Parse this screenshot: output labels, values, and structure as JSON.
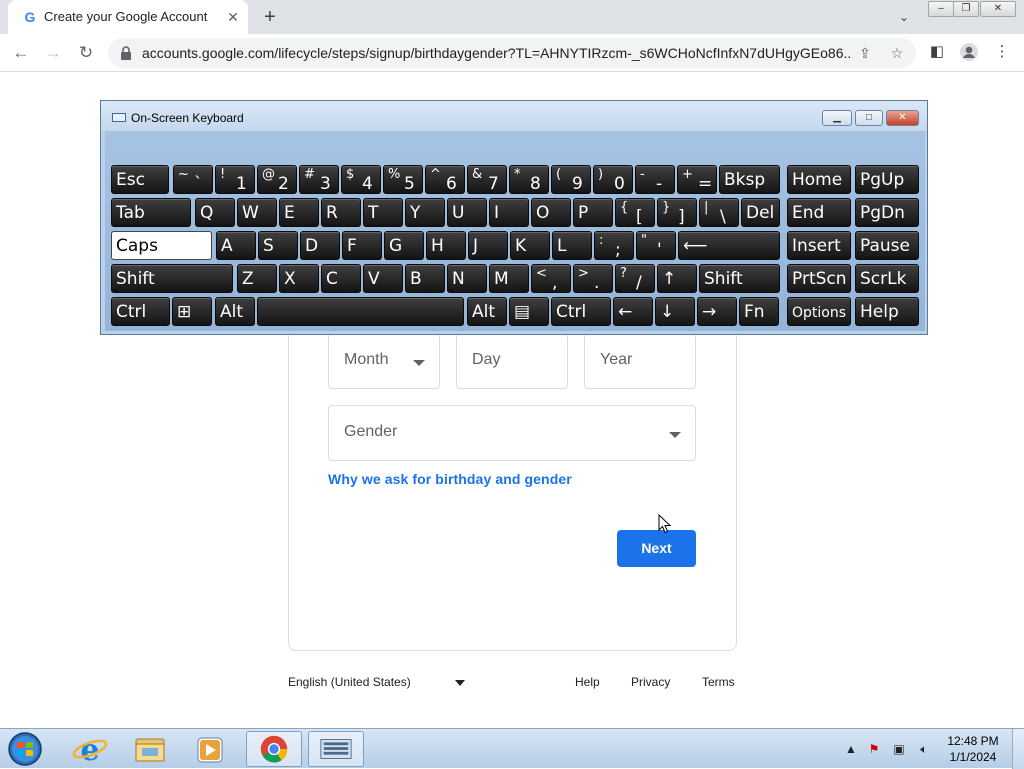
{
  "browser": {
    "tab_title": "Create your Google Account",
    "tab_favicon": "G",
    "url": "accounts.google.com/lifecycle/steps/signup/birthdaygender?TL=AHNYTIRzcm-_s6WCHoNcfInfxN7dUHgyGEo86..."
  },
  "form": {
    "month_placeholder": "Month",
    "day_placeholder": "Day",
    "year_placeholder": "Year",
    "gender_placeholder": "Gender",
    "why_link": "Why we ask for birthday and gender",
    "next_label": "Next"
  },
  "footer": {
    "language": "English (United States)",
    "help": "Help",
    "privacy": "Privacy",
    "terms": "Terms"
  },
  "osk": {
    "title": "On-Screen Keyboard",
    "rows": [
      [
        {
          "label": "Esc"
        },
        {
          "shift": "~",
          "main": "`"
        },
        {
          "shift": "!",
          "main": "1"
        },
        {
          "shift": "@",
          "main": "2"
        },
        {
          "shift": "#",
          "main": "3"
        },
        {
          "shift": "$",
          "main": "4"
        },
        {
          "shift": "%",
          "main": "5"
        },
        {
          "shift": "^",
          "main": "6"
        },
        {
          "shift": "&",
          "main": "7"
        },
        {
          "shift": "*",
          "main": "8"
        },
        {
          "shift": "(",
          "main": "9"
        },
        {
          "shift": ")",
          "main": "0"
        },
        {
          "shift": "-",
          "main": "-"
        },
        {
          "shift": "+",
          "main": "="
        },
        {
          "label": "Bksp"
        },
        {
          "label": "Home"
        },
        {
          "label": "PgUp"
        }
      ],
      [
        {
          "label": "Tab"
        },
        {
          "label": "Q"
        },
        {
          "label": "W"
        },
        {
          "label": "E"
        },
        {
          "label": "R"
        },
        {
          "label": "T"
        },
        {
          "label": "Y"
        },
        {
          "label": "U"
        },
        {
          "label": "I"
        },
        {
          "label": "O"
        },
        {
          "label": "P"
        },
        {
          "shift": "{",
          "main": "["
        },
        {
          "shift": "}",
          "main": "]"
        },
        {
          "shift": "|",
          "main": "\\"
        },
        {
          "label": "Del"
        },
        {
          "label": "End"
        },
        {
          "label": "PgDn"
        }
      ],
      [
        {
          "label": "Caps"
        },
        {
          "label": "A"
        },
        {
          "label": "S"
        },
        {
          "label": "D"
        },
        {
          "label": "F"
        },
        {
          "label": "G"
        },
        {
          "label": "H"
        },
        {
          "label": "J"
        },
        {
          "label": "K"
        },
        {
          "label": "L"
        },
        {
          "shift": ":",
          "main": ";"
        },
        {
          "shift": "\"",
          "main": "'"
        },
        {
          "label": "⟵"
        },
        {
          "label": "Insert"
        },
        {
          "label": "Pause"
        }
      ],
      [
        {
          "label": "Shift"
        },
        {
          "label": "Z"
        },
        {
          "label": "X"
        },
        {
          "label": "C"
        },
        {
          "label": "V"
        },
        {
          "label": "B"
        },
        {
          "label": "N"
        },
        {
          "label": "M"
        },
        {
          "shift": "<",
          "main": ","
        },
        {
          "shift": ">",
          "main": "."
        },
        {
          "shift": "?",
          "main": "/"
        },
        {
          "label": "↑"
        },
        {
          "label": "Shift"
        },
        {
          "label": "PrtScn"
        },
        {
          "label": "ScrLk"
        }
      ],
      [
        {
          "label": "Ctrl"
        },
        {
          "label": "⊞"
        },
        {
          "label": "Alt"
        },
        {
          "label": ""
        },
        {
          "label": "Alt"
        },
        {
          "label": "▤"
        },
        {
          "label": "Ctrl"
        },
        {
          "label": "←"
        },
        {
          "label": "↓"
        },
        {
          "label": "→"
        },
        {
          "label": "Fn"
        },
        {
          "label": "Options"
        },
        {
          "label": "Help"
        }
      ]
    ]
  },
  "taskbar": {
    "time": "12:48 PM",
    "date": "1/1/2024",
    "apps": [
      "start-orb",
      "internet-explorer",
      "file-explorer",
      "media-player",
      "chrome",
      "on-screen-keyboard"
    ]
  },
  "colors": {
    "accent": "#1a73e8",
    "osk_key": "#1e1e1e",
    "osk_frame": "#b9d1ea"
  }
}
